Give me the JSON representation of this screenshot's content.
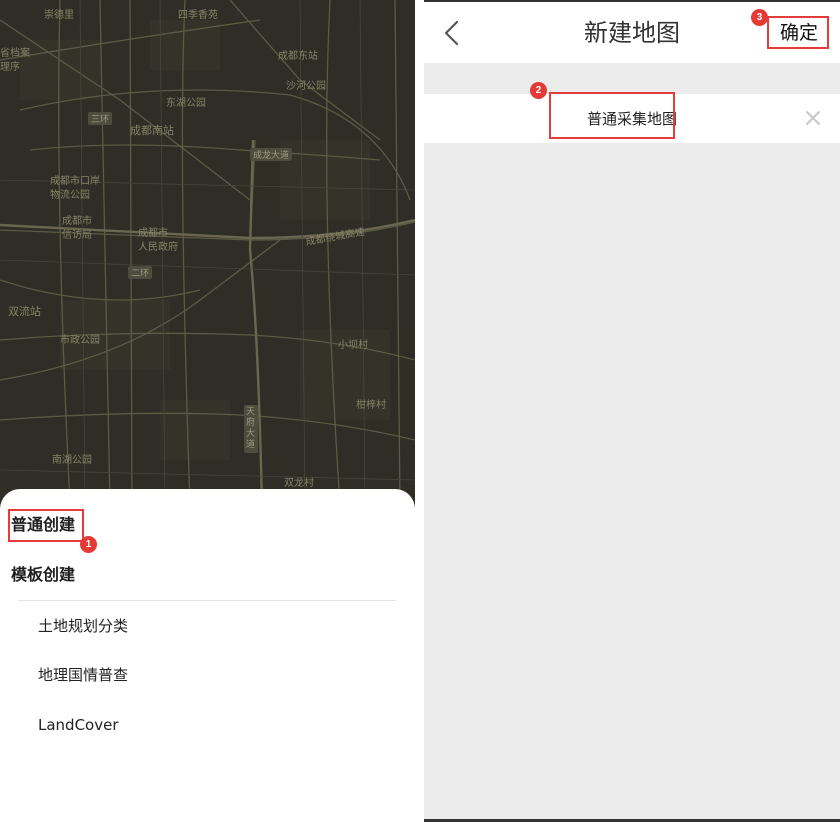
{
  "left_panel": {
    "map": {
      "labels": [
        "崇德里",
        "四季香苑",
        "省档案",
        "理序",
        "成都东站",
        "东湖公园",
        "沙河公园",
        "成都南站",
        "成都市口岸",
        "物流公园",
        "成都市",
        "信访局",
        "成都市",
        "人民政府",
        "成都绕城高速",
        "双流站",
        "市政公园",
        "小坝村",
        "南湖公园",
        "柑梓村",
        "双龙村"
      ],
      "badges": [
        "三环",
        "成龙大道",
        "二环",
        "天府大道"
      ]
    },
    "sheet": {
      "normal_create": "普通创建",
      "template_create": "模板创建",
      "templates": [
        "土地规划分类",
        "地理国情普查",
        "LandCover"
      ]
    },
    "annotations": {
      "step1": "1"
    }
  },
  "right_panel": {
    "navbar": {
      "back_icon": "chevron-left-icon",
      "title": "新建地图",
      "confirm_label": "确定"
    },
    "name_field": {
      "value": "普通采集地图",
      "clear_icon": "close-icon"
    },
    "annotations": {
      "step2": "2",
      "step3": "3"
    }
  },
  "colors": {
    "annotation": "#e43b3b",
    "map_bg": "#2e2d26",
    "map_road": "#5e5a45",
    "panel_bg": "#ececec"
  }
}
